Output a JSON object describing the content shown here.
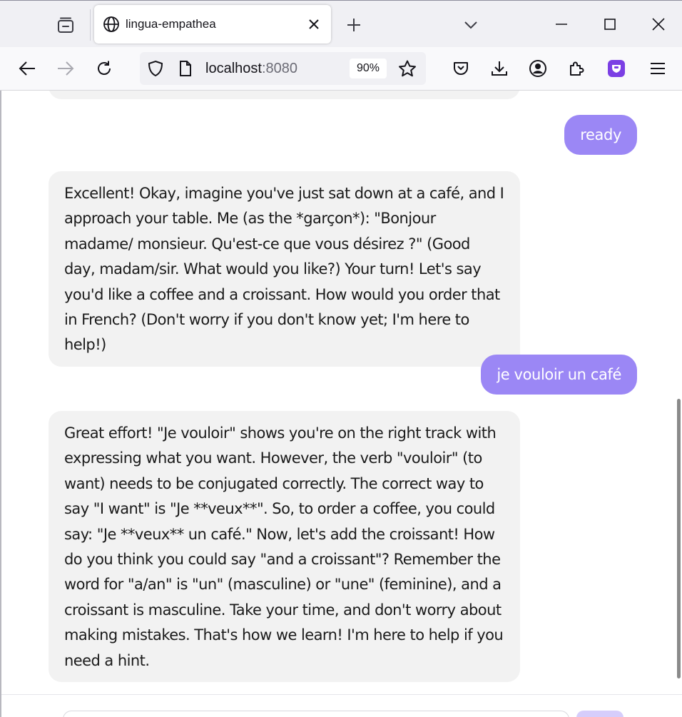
{
  "browser": {
    "tab": {
      "title": "lingua-empathea"
    },
    "url": {
      "host": "localhost",
      "port": ":8080"
    },
    "zoom": "90%"
  },
  "chat": {
    "messages": [
      {
        "role": "user",
        "text": "ready"
      },
      {
        "role": "assistant",
        "text": "Excellent! Okay, imagine you've just sat down at a café, and I approach your table. Me (as the *garçon*): \"Bonjour madame/ monsieur. Qu'est-ce que vous désirez ?\" (Good day, madam/sir. What would you like?) Your turn! Let's say you'd like a coffee and a croissant. How would you order that in French? (Don't worry if you don't know yet; I'm here to help!)"
      },
      {
        "role": "user",
        "text": "je vouloir un café"
      },
      {
        "role": "assistant",
        "text": "Great effort! \"Je vouloir\" shows you're on the right track with expressing what you want. However, the verb \"vouloir\" (to want) needs to be conjugated correctly. The correct way to say \"I want\" is \"Je **veux**\". So, to order a coffee, you could say: \"Je **veux** un café.\" Now, let's add the croissant! How do you think you could say \"and a croissant\"? Remember the word for \"a/an\" is \"un\" (masculine) or \"une\" (feminine), and a croissant is masculine. Take your time, and don't worry about making mistakes. That's how we learn! I'm here to help if you need a hint."
      }
    ]
  },
  "colors": {
    "user_bubble": "#9b87f5",
    "assistant_bubble": "#f2f2f2",
    "send_button": "#d6cdfb"
  }
}
